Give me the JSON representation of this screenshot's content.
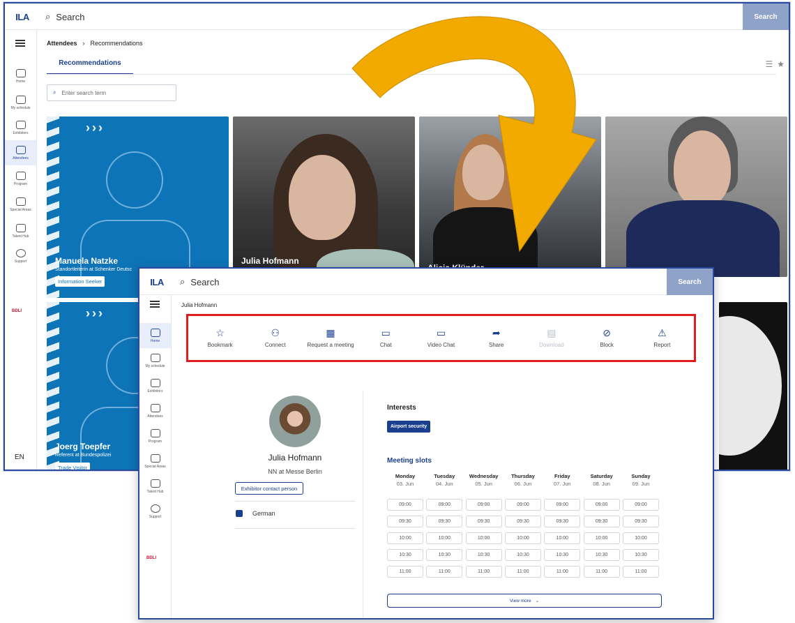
{
  "app": {
    "logo": "ILA",
    "search_label": "Search",
    "search_button": "Search",
    "brand": "BDLI",
    "lang": "EN"
  },
  "sidebar": {
    "items": [
      {
        "label": "Home",
        "icon": "home-icon"
      },
      {
        "label": "My schedule",
        "icon": "schedule-icon"
      },
      {
        "label": "Exhibitors",
        "icon": "grid-icon"
      },
      {
        "label": "Attendees",
        "icon": "attendees-icon"
      },
      {
        "label": "Program",
        "icon": "calendar-icon"
      },
      {
        "label": "Special Areas",
        "icon": "plane-icon"
      },
      {
        "label": "Talent Hub",
        "icon": "rocket-icon"
      },
      {
        "label": "Support",
        "icon": "help-icon"
      }
    ]
  },
  "list_view": {
    "breadcrumb": [
      "Attendees",
      "Recommendations"
    ],
    "tab": "Recommendations",
    "search_placeholder": "Enter search term",
    "cards": [
      {
        "name": "Manuela Natzke",
        "subtitle": "Standortleiterin at Schenker Deutsc",
        "tag": "Information Seeker"
      },
      {
        "name": "Julia Hofmann"
      },
      {
        "name": "Alicia Klünder"
      },
      {
        "name": ""
      },
      {
        "name": "Joerg Toepfer",
        "subtitle": "Referent at Bundespolizei",
        "tag": "Trade Visitor"
      }
    ]
  },
  "detail_view": {
    "title": "Julia Hofmann",
    "actions": [
      {
        "label": "Bookmark",
        "icon": "star-icon",
        "disabled": false
      },
      {
        "label": "Connect",
        "icon": "connect-icon",
        "disabled": false
      },
      {
        "label": "Request a meeting",
        "icon": "calendar-icon",
        "disabled": false
      },
      {
        "label": "Chat",
        "icon": "chat-icon",
        "disabled": false
      },
      {
        "label": "Video Chat",
        "icon": "video-icon",
        "disabled": false
      },
      {
        "label": "Share",
        "icon": "share-icon",
        "disabled": false
      },
      {
        "label": "Download",
        "icon": "download-icon",
        "disabled": true
      },
      {
        "label": "Block",
        "icon": "block-icon",
        "disabled": false
      },
      {
        "label": "Report",
        "icon": "warning-icon",
        "disabled": false
      }
    ],
    "profile": {
      "name": "Julia Hofmann",
      "role": "NN at Messe Berlin",
      "badge": "Exhibitor contact person",
      "language": "German"
    },
    "interests_heading": "Interests",
    "interests": [
      "Airport security"
    ],
    "meeting_heading": "Meeting slots",
    "days": [
      {
        "name": "Monday",
        "date": "03. Jun"
      },
      {
        "name": "Tuesday",
        "date": "04. Jun"
      },
      {
        "name": "Wednesday",
        "date": "05. Jun"
      },
      {
        "name": "Thursday",
        "date": "06. Jun"
      },
      {
        "name": "Friday",
        "date": "07. Jun"
      },
      {
        "name": "Saturday",
        "date": "08. Jun"
      },
      {
        "name": "Sunday",
        "date": "09. Jun"
      }
    ],
    "times": [
      "09:00",
      "09:30",
      "10:00",
      "10:30",
      "11:00"
    ],
    "view_more": "View more"
  },
  "colors": {
    "primary": "#1b3f8f",
    "card_blue": "#0e74b8",
    "highlight": "#e11c1c",
    "arrow": "#f2aa00"
  }
}
